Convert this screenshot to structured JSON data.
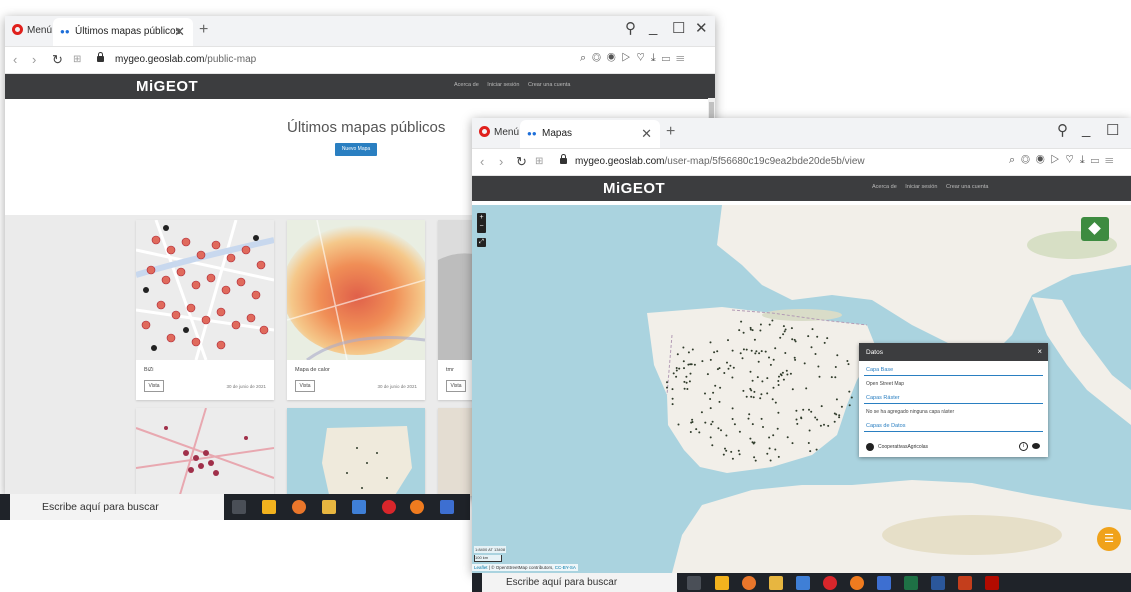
{
  "left_window": {
    "menu_label": "Menú",
    "tab_title": "Últimos mapas públicos",
    "url_domain": "mygeo.geoslab.com",
    "url_path": "/public-map",
    "brand": "MiGEOT",
    "nav_links": [
      "Acerca de",
      "Iniciar sesión",
      "Crear una cuenta"
    ],
    "hero_title": "Últimos mapas públicos",
    "new_map_button": "Nuevo Mapa",
    "cards": [
      {
        "title": "BiZi",
        "view_label": "Vista",
        "date": "30 de junio de 2021"
      },
      {
        "title": "Mapa de calor",
        "view_label": "Vista",
        "date": "30 de junio de 2021"
      },
      {
        "title": "tmr",
        "view_label": "Vista",
        "date": ""
      }
    ]
  },
  "right_window": {
    "menu_label": "Menú",
    "tab_title": "Mapas",
    "url_domain": "mygeo.geoslab.com",
    "url_path": "/user-map/5f56680c19c9ea2bde20de5b/view",
    "brand": "MiGEOT",
    "nav_links": [
      "Acerca de",
      "Iniciar sesión",
      "Crear una cuenta"
    ],
    "panel": {
      "title": "Datos",
      "sections": [
        {
          "title": "Capa Base",
          "item": "Open Street Map"
        },
        {
          "title": "Capas Ráster",
          "item": "No se ha agregado ninguna capa ráster"
        },
        {
          "title": "Capas de Datos",
          "item": ""
        }
      ],
      "layer_name": "CooperativasAgricolas"
    },
    "map": {
      "scale_info": "1:8400 AT 13408",
      "scale_label": "100 km",
      "attribution_leaflet": "Leaflet",
      "attribution_text": " | © OpenStreetMap contributors, ",
      "attribution_license": "CC-BY-SA"
    }
  },
  "taskbar": {
    "search_text": "Escribe aquí para buscar"
  },
  "colors": {
    "navbar": "#3c3d3f",
    "accent_blue": "#2a7fc1",
    "layers_green": "#3d8b40",
    "fab_orange": "#f0a21a",
    "opera_red": "#e0201c"
  }
}
